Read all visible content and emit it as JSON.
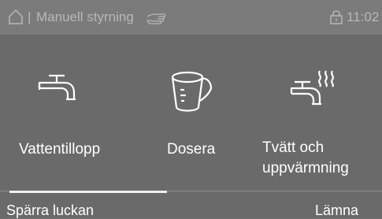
{
  "header": {
    "separator": "|",
    "title": "Manuell styrning",
    "time": "11:02",
    "icons": [
      "home-icon",
      "hand-icon",
      "lock-icon"
    ]
  },
  "tiles": [
    {
      "label": "Vattentillopp",
      "icon": "water-tap-icon"
    },
    {
      "label": "Dosera",
      "icon": "measuring-cup-icon"
    },
    {
      "label_line1": "Tvätt och",
      "label_line2": "uppvärmning",
      "icon": "heated-tap-icon"
    }
  ],
  "footer": {
    "lock_label": "Spärra luckan",
    "leave_label": "Lämna"
  },
  "colors": {
    "background": "#6e6e6e",
    "header_text": "#b8b8b8",
    "text": "#ffffff",
    "indicator": "#f0f0f0"
  }
}
